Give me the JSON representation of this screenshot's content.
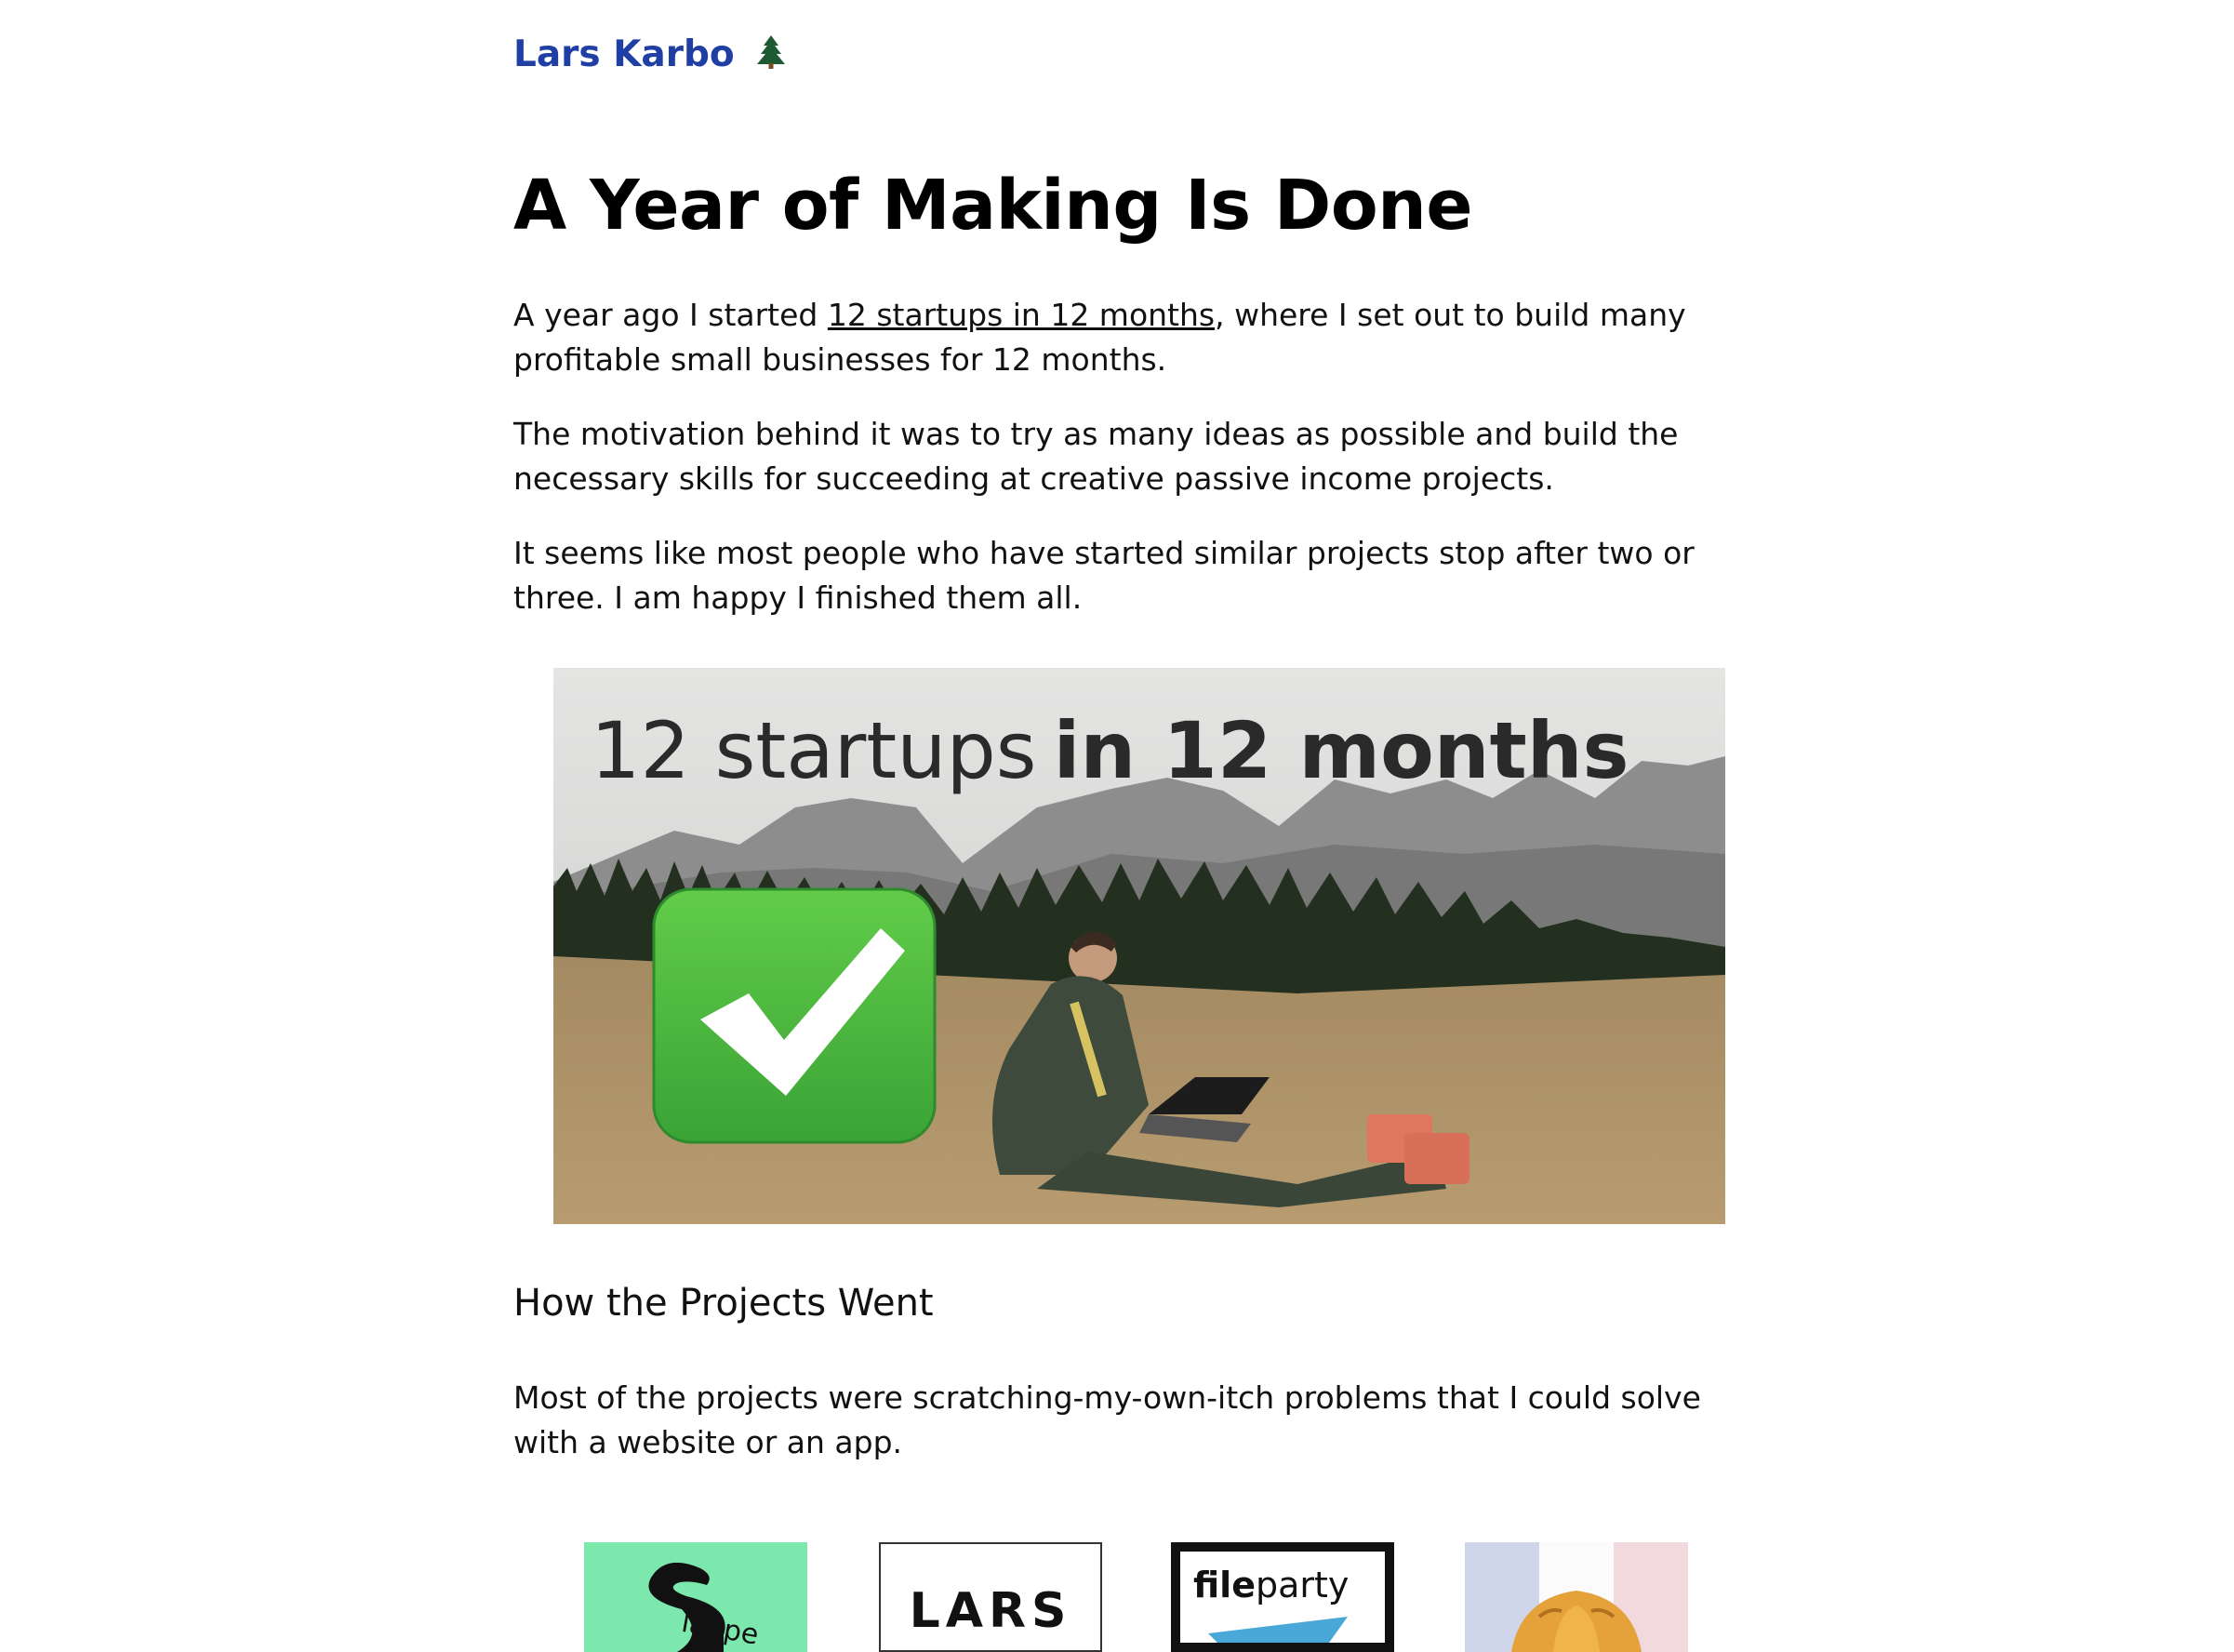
{
  "site": {
    "name": "Lars Karbo",
    "icon": "evergreen-tree-icon"
  },
  "post": {
    "title": "A Year of Making Is Done",
    "intro": {
      "before_link": "A year ago I started ",
      "link_text": "12 startups in 12 months",
      "after_link": ", where I set out to build many profitable small businesses for 12 months."
    },
    "paragraph_2": "The motivation behind it was to try as many ideas as possible and build the necessary skills for succeeding at creative passive income projects.",
    "paragraph_3": "It seems like most people who have started similar projects stop after two or three. I am happy I finished them all.",
    "hero_image": {
      "caption_light": "12 startups",
      "caption_bold": "in 12 months",
      "icon": "check-mark-button-icon"
    },
    "section_heading": "How the Projects Went",
    "paragraph_4": "Most of the projects were scratching-my-own-itch problems that I could solve with a website or an app.",
    "project_thumbnails": [
      {
        "name": "slappe-logo",
        "text": "lappe",
        "color": "#7de8ad"
      },
      {
        "name": "lars-logo",
        "text": "LARS"
      },
      {
        "name": "fileparty-logo",
        "text_bold": "file",
        "text_light": "party",
        "accent": "#4aa8d8"
      },
      {
        "name": "croissant-logo",
        "icon": "croissant-icon"
      }
    ]
  },
  "colors": {
    "link_blue": "#1f3fa4",
    "text": "#111111",
    "background": "#ffffff"
  }
}
